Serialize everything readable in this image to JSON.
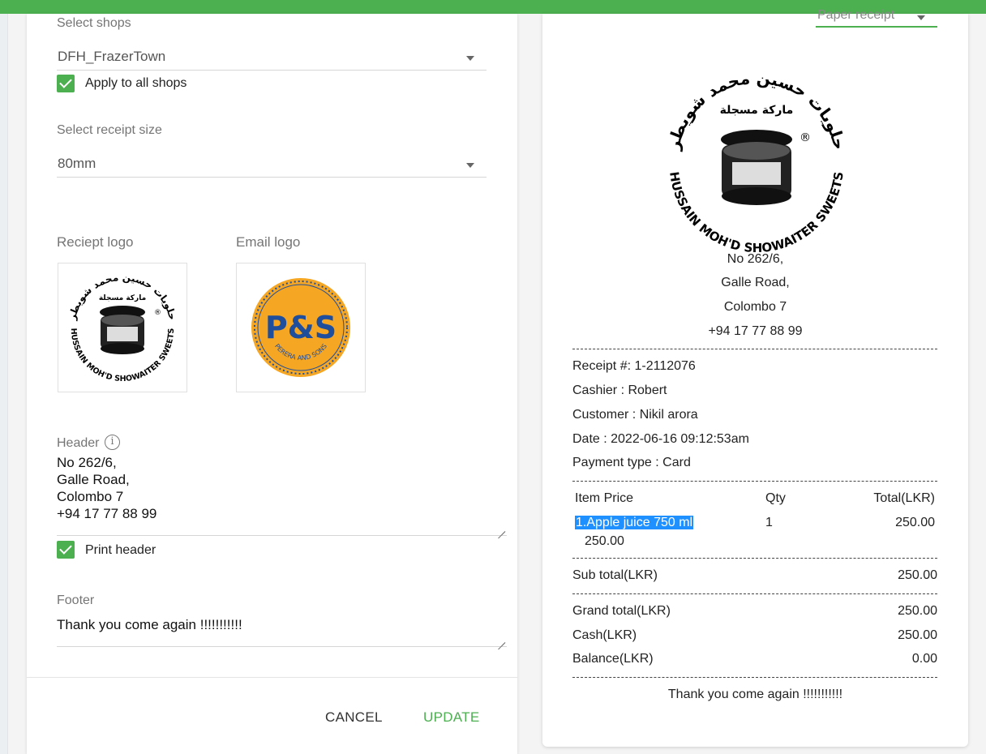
{
  "left_panel": {
    "shop_label": "Select shops",
    "shop_value": "DFH_FrazerTown",
    "apply_all_label": "Apply to all shops",
    "size_label": "Select receipt size",
    "size_value": "80mm",
    "receipt_logo_label": "Reciept logo",
    "email_logo_label": "Email logo",
    "email_logo": {
      "title": "P&S",
      "subtitle": "PERERA AND SONS"
    },
    "receipt_logo": {
      "arabic_top": "حلويات حسين محمد شويطر",
      "arabic_mid": "ماركة مسجلة",
      "english": "HUSSAIN MOH'D SHOWAITER SWEETS",
      "reg": "®"
    },
    "header_label": "Header",
    "header_lines": [
      "No 262/6,",
      "Galle Road,",
      "Colombo 7",
      "+94 17 77 88 99"
    ],
    "print_header_label": "Print header",
    "footer_label": "Footer",
    "footer_value": "Thank you come again !!!!!!!!!!!",
    "cancel_label": "CANCEL",
    "update_label": "UPDATE"
  },
  "right_panel": {
    "receipt_type": "Paper receipt",
    "address": [
      "No 262/6,",
      "Galle Road,",
      "Colombo 7",
      "+94 17 77 88 99"
    ],
    "receipt_no": "Receipt #: 1-2112076",
    "cashier": "Cashier : Robert",
    "customer": "Customer : Nikil arora",
    "date": "Date : 2022-06-16 09:12:53am",
    "payment": "Payment type : Card",
    "col_item": "Item Price",
    "col_qty": "Qty",
    "col_total": "Total(LKR)",
    "item_name": "1.Apple juice 750 ml",
    "item_price": "250.00",
    "item_qty": "1",
    "item_total": "250.00",
    "subtotal_label": "Sub total(LKR)",
    "subtotal_value": "250.00",
    "grand_label": "Grand total(LKR)",
    "grand_value": "250.00",
    "cash_label": "Cash(LKR)",
    "cash_value": "250.00",
    "balance_label": "Balance(LKR)",
    "balance_value": "0.00",
    "footer": "Thank you come again !!!!!!!!!!!"
  },
  "colors": {
    "accent": "#4caf50",
    "selection": "#1e90ff",
    "email_logo_bg": "#f5a623",
    "email_logo_text": "#1f4e9c"
  }
}
